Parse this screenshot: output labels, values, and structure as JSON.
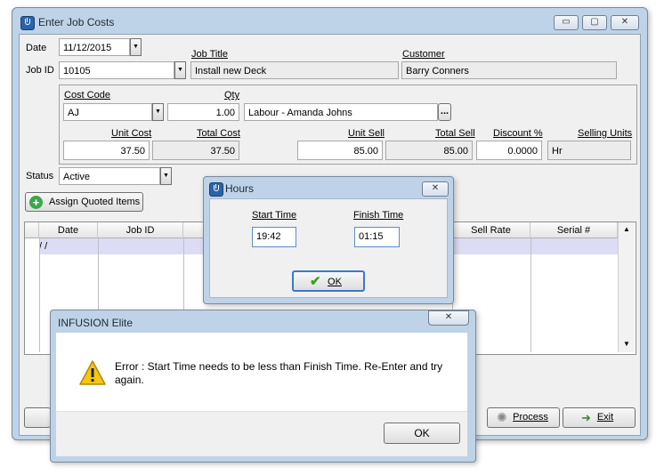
{
  "main_window": {
    "title": "Enter Job Costs",
    "date_label": "Date",
    "date_value": "11/12/2015",
    "job_id_label": "Job ID",
    "job_id_value": "10105",
    "job_title_label": "Job Title",
    "job_title_value": "Install new Deck",
    "customer_label": "Customer",
    "customer_value": "Barry Conners",
    "cost_code_label": "Cost Code",
    "cost_code_value": "AJ",
    "qty_label": "Qty",
    "qty_value": "1.00",
    "description_value": "Labour - Amanda Johns",
    "browse_label": "...",
    "unit_cost_label": "Unit Cost",
    "unit_cost_value": "37.50",
    "total_cost_label": "Total Cost",
    "total_cost_value": "37.50",
    "unit_sell_label": "Unit Sell",
    "unit_sell_value": "85.00",
    "total_sell_label": "Total Sell",
    "total_sell_value": "85.00",
    "discount_label": "Discount %",
    "discount_value": "0.0000",
    "selling_units_label": "Selling Units",
    "selling_units_value": "Hr",
    "status_label": "Status",
    "status_value": "Active",
    "assign_button_label": "Assign Quoted Items",
    "grid_headers": [
      "Date",
      "Job ID",
      "Sell Rate",
      "Serial #"
    ],
    "grid_first_row_date": " /  /",
    "process_button_label": "Process",
    "exit_button_label": "Exit"
  },
  "hours_dialog": {
    "title": "Hours",
    "start_time_label": "Start Time",
    "start_time_value": "19:42",
    "finish_time_label": "Finish Time",
    "finish_time_value": "01:15",
    "ok_label": "OK"
  },
  "error_dialog": {
    "title": "INFUSION Elite",
    "message": "Error : Start Time needs to be less than Finish Time. Re-Enter and try again.",
    "ok_label": "OK"
  },
  "colors": {
    "frame": "#bfd3e8",
    "grid_highlight_row": "#dcdcf4",
    "ok_check": "#3aa020"
  }
}
